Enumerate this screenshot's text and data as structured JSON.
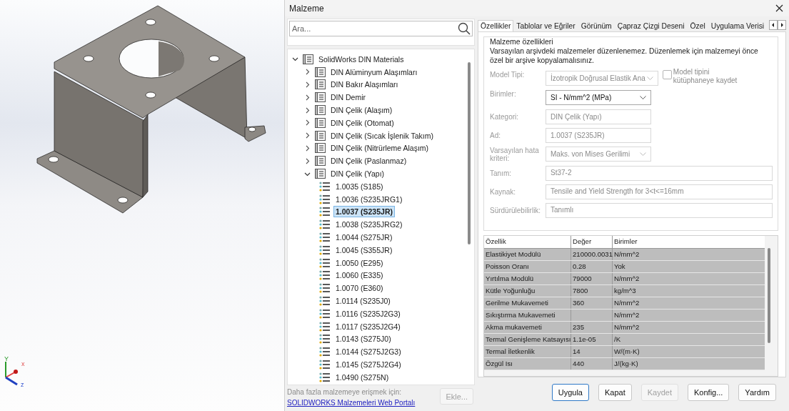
{
  "viewport": {
    "axis_labels": [
      "Y",
      "x",
      "z"
    ]
  },
  "window": {
    "title": "Malzeme"
  },
  "search": {
    "placeholder": "Ara..."
  },
  "tree": [
    {
      "label": "SolidWorks DIN Materials",
      "kind": "folder",
      "expanded": true,
      "selected": false,
      "children": [
        {
          "label": "DIN Alüminyum Alaşımları",
          "kind": "folder",
          "expanded": false,
          "selected": false
        },
        {
          "label": "DIN Bakır Alaşımları",
          "kind": "folder",
          "expanded": false,
          "selected": false
        },
        {
          "label": "DIN Demir",
          "kind": "folder",
          "expanded": false,
          "selected": false
        },
        {
          "label": "DIN Çelik (Alaşım)",
          "kind": "folder",
          "expanded": false,
          "selected": false
        },
        {
          "label": "DIN Çelik (Otomat)",
          "kind": "folder",
          "expanded": false,
          "selected": false
        },
        {
          "label": "DIN Çelik (Sıcak İşlenik Takım)",
          "kind": "folder",
          "expanded": false,
          "selected": false
        },
        {
          "label": "DIN Çelik (Nitrürleme Alaşım)",
          "kind": "folder",
          "expanded": false,
          "selected": false
        },
        {
          "label": "DIN Çelik (Paslanmaz)",
          "kind": "folder",
          "expanded": false,
          "selected": false
        },
        {
          "label": "DIN Çelik (Yapı)",
          "kind": "folder",
          "expanded": true,
          "selected": false,
          "children": [
            {
              "label": "1.0035 (S185)",
              "kind": "material",
              "selected": false
            },
            {
              "label": "1.0036 (S235JRG1)",
              "kind": "material",
              "selected": false
            },
            {
              "label": "1.0037 (S235JR)",
              "kind": "material",
              "selected": true
            },
            {
              "label": "1.0038 (S235JRG2)",
              "kind": "material",
              "selected": false
            },
            {
              "label": "1.0044 (S275JR)",
              "kind": "material",
              "selected": false
            },
            {
              "label": "1.0045 (S355JR)",
              "kind": "material",
              "selected": false
            },
            {
              "label": "1.0050 (E295)",
              "kind": "material",
              "selected": false
            },
            {
              "label": "1.0060 (E335)",
              "kind": "material",
              "selected": false
            },
            {
              "label": "1.0070 (E360)",
              "kind": "material",
              "selected": false
            },
            {
              "label": "1.0114 (S235J0)",
              "kind": "material",
              "selected": false
            },
            {
              "label": "1.0116 (S235J2G3)",
              "kind": "material",
              "selected": false
            },
            {
              "label": "1.0117 (S235J2G4)",
              "kind": "material",
              "selected": false
            },
            {
              "label": "1.0143 (S275J0)",
              "kind": "material",
              "selected": false
            },
            {
              "label": "1.0144 (S275J2G3)",
              "kind": "material",
              "selected": false
            },
            {
              "label": "1.0145 (S275J2G4)",
              "kind": "material",
              "selected": false
            },
            {
              "label": "1.0490 (S275N)",
              "kind": "material",
              "selected": false
            }
          ]
        }
      ]
    }
  ],
  "footer": {
    "note": "Daha fazla malzemeye erişmek için:",
    "link": "SOLIDWORKS Malzemeleri Web Portalı",
    "button": {
      "label": "Ekle...",
      "disabled": true
    }
  },
  "tabs": [
    {
      "label": "Özellikler",
      "selected": true
    },
    {
      "label": "Tablolar ve Eğriler",
      "selected": false
    },
    {
      "label": "Görünüm",
      "selected": false
    },
    {
      "label": "Çapraz Çizgi Deseni",
      "selected": false
    },
    {
      "label": "Özel",
      "selected": false
    },
    {
      "label": "Uygulama Verisi",
      "selected": false
    }
  ],
  "properties_group": {
    "title": "Malzeme özellikleri",
    "notice": "Varsayılan arşivdeki malzemeler düzenlenemez. Düzenlemek için malzemeyi önce özel bir arşive kopyalamalısınız.",
    "fields": [
      {
        "label": "Model Tipi:",
        "kind": "dropdown",
        "value": "İzotropik Doğrusal Elastik Ana",
        "disabled": true
      },
      {
        "label": "Birimler:",
        "kind": "dropdown",
        "value": "SI - N/mm^2 (MPa)",
        "disabled": false
      },
      {
        "label": "Kategori:",
        "kind": "text",
        "value": "DIN Çelik (Yapı)",
        "disabled": true
      },
      {
        "label": "Ad:",
        "kind": "text",
        "value": "1.0037 (S235JR)",
        "disabled": true
      },
      {
        "label": "Varsayılan hata kriteri:",
        "kind": "dropdown",
        "value": "Maks. von Mises Gerilimi",
        "disabled": true
      },
      {
        "label": "Tanım:",
        "kind": "wide_text",
        "value": "St37-2",
        "disabled": true
      },
      {
        "label": "Kaynak:",
        "kind": "wide_text",
        "value": "Tensile and Yield Strength for 3<t<=16mm",
        "disabled": true
      },
      {
        "label": "Sürdürülebilirlik:",
        "kind": "wide_text",
        "value": "Tanımlı",
        "disabled": true
      }
    ],
    "save_model_type": {
      "label": "Model tipini kütüphaneye kaydet",
      "checked": false,
      "disabled": true
    }
  },
  "table": {
    "columns": [
      "Özellik",
      "Değer",
      "Birimler"
    ],
    "rows": [
      [
        "Elastikiyet Modülü",
        "210000.0031",
        "N/mm^2"
      ],
      [
        "Poisson Oranı",
        "0.28",
        "Yok"
      ],
      [
        "Yırtılma Modülü",
        "79000",
        "N/mm^2"
      ],
      [
        "Kütle Yoğunluğu",
        "7800",
        "kg/m^3"
      ],
      [
        "Gerilme Mukavemeti",
        "360",
        "N/mm^2"
      ],
      [
        "Sıkıştırma Mukavemeti",
        "",
        "N/mm^2"
      ],
      [
        "Akma mukavemeti",
        "235",
        "N/mm^2"
      ],
      [
        "Termal Genişleme Katsayısı",
        "1.1e-05",
        "/K"
      ],
      [
        "Termal İletkenlik",
        "14",
        "W/(m·K)"
      ],
      [
        "Özgül Isı",
        "440",
        "J/(kg·K)"
      ]
    ]
  },
  "buttons": [
    {
      "label": "Uygula",
      "disabled": false,
      "default": true
    },
    {
      "label": "Kapat",
      "disabled": false,
      "default": false
    },
    {
      "label": "Kaydet",
      "disabled": true,
      "default": false
    },
    {
      "label": "Konfig...",
      "disabled": false,
      "default": false
    },
    {
      "label": "Yardım",
      "disabled": false,
      "default": false
    }
  ]
}
